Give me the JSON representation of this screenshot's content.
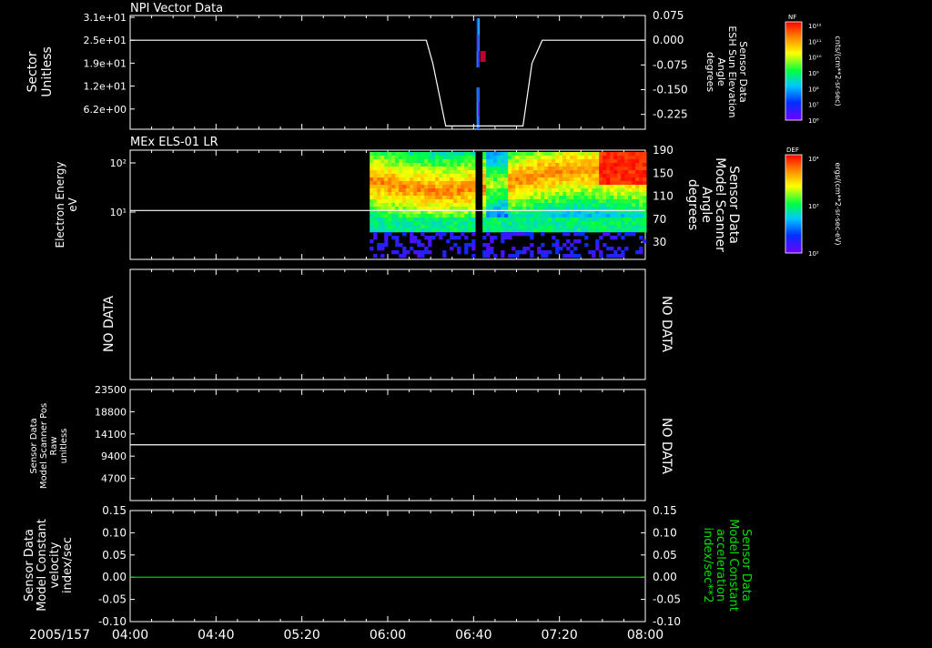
{
  "date_label": "2005/157",
  "time_ticks": [
    "04:00",
    "04:40",
    "05:20",
    "06:00",
    "06:40",
    "07:20",
    "08:00"
  ],
  "time_range_hours": [
    4,
    8
  ],
  "colors": {
    "frame": "#ffffff",
    "background": "#000000",
    "green_trace": "#00e000"
  },
  "chart_data": [
    {
      "id": "npi",
      "type": "heatmap",
      "title": "NPI Vector Data",
      "ylabel_lines": [
        "Sector",
        "Unitless"
      ],
      "y_ticks": [
        "3.1e+01",
        "2.5e+01",
        "1.9e+01",
        "1.2e+01",
        "6.2e+00"
      ],
      "y2_label_lines": [
        "Sensor Data",
        "ESH Sun Elevation",
        "Angle",
        "degrees"
      ],
      "y2_ticks": [
        "0.075",
        "0.000",
        "-0.075",
        "-0.150",
        "-0.225"
      ],
      "y2_range": [
        -0.27,
        0.075
      ],
      "line_series": {
        "name": "",
        "x": [
          4.0,
          6.3,
          6.35,
          6.45,
          6.7,
          7.05,
          7.12,
          7.2,
          8.0
        ],
        "y": [
          0.0,
          0.0,
          -0.07,
          -0.26,
          -0.26,
          -0.26,
          -0.07,
          0.0,
          0.0
        ]
      },
      "data_band_x": [
        6.69,
        6.71
      ],
      "colorbar": {
        "label": "NF",
        "units": "cnts/(cm**2-sr-sec)",
        "ticks": [
          "10¹²",
          "10¹¹",
          "10¹⁰",
          "10⁹",
          "10⁸",
          "10⁷",
          "10⁶"
        ]
      }
    },
    {
      "id": "els",
      "type": "heatmap",
      "title": "MEx ELS-01 LR",
      "ylabel_lines": [
        "Electron Energy",
        "eV"
      ],
      "y_ticks": [
        "10²",
        "10¹"
      ],
      "y_scale": "log",
      "y2_label_lines": [
        "Sensor Data",
        "Model Scanner",
        "Angle",
        "degrees"
      ],
      "y2_ticks": [
        "190",
        "150",
        "110",
        "70",
        "30"
      ],
      "y2_range": [
        0,
        190
      ],
      "line_series": {
        "name": "",
        "x": [
          4.0,
          8.0
        ],
        "y": [
          85,
          85
        ]
      },
      "data_coverage_x": [
        5.86,
        8.0
      ],
      "data_gap_x": [
        6.7,
        6.73
      ],
      "colorbar": {
        "label": "DEF",
        "units": "ergs/(cm**2-sr-sec-eV)",
        "ticks": [
          "10⁴",
          "10³",
          "10²"
        ]
      }
    },
    {
      "id": "nodata1",
      "type": "line",
      "left_label": "NO DATA",
      "right_label": "NO DATA"
    },
    {
      "id": "scanner",
      "type": "line",
      "ylabel_lines": [
        "Sensor Data",
        "Model Scanner Pos",
        "Raw",
        "unitless"
      ],
      "y_ticks": [
        "23500",
        "18800",
        "14100",
        "9400",
        "4700"
      ],
      "y_range": [
        0,
        23500
      ],
      "right_label": "NO DATA",
      "series": [
        {
          "name": "",
          "x": [
            4.0,
            8.0
          ],
          "y": [
            11800,
            11800
          ]
        }
      ]
    },
    {
      "id": "constant",
      "type": "line",
      "ylabel_lines": [
        "Sensor Data",
        "Model Constant",
        "velocity",
        "index/sec"
      ],
      "y_ticks": [
        "0.15",
        "0.10",
        "0.05",
        "0.00",
        "-0.05",
        "-0.10"
      ],
      "y_range": [
        -0.1,
        0.15
      ],
      "y2_label_lines": [
        "Sensor Data",
        "Model Constant",
        "acceleration",
        "index/sec**2"
      ],
      "y2_ticks": [
        "0.15",
        "0.10",
        "0.05",
        "0.00",
        "-0.05",
        "-0.10"
      ],
      "series": [
        {
          "name": "",
          "x": [
            4.0,
            8.0
          ],
          "y": [
            0.0,
            0.0
          ]
        }
      ]
    }
  ]
}
